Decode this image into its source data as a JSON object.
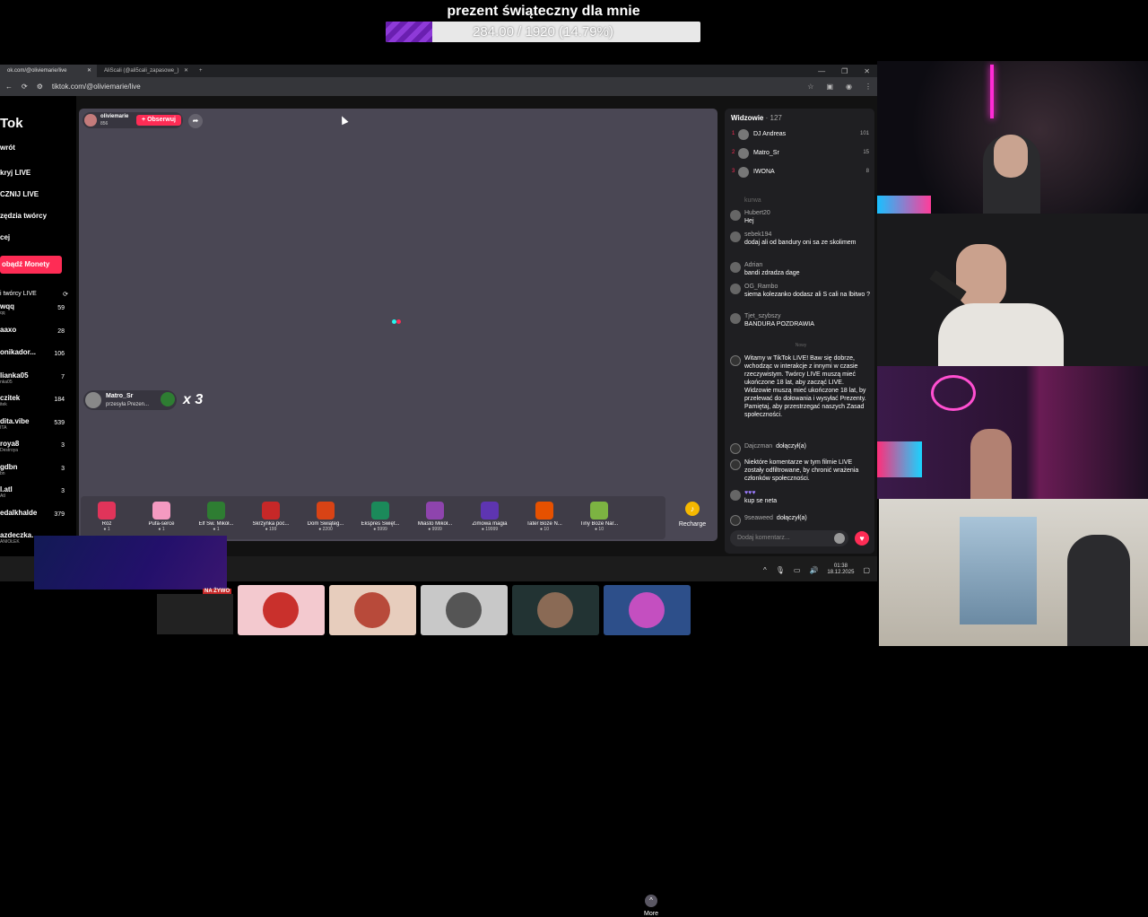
{
  "goal": {
    "title": "prezent świąteczny dla mnie",
    "progress_text": "284.00 / 1920 (14.79%)",
    "fraction": 0.1479
  },
  "browser": {
    "tabs": [
      {
        "label": "ok.com/@oliviemarie/live",
        "active": true
      },
      {
        "label": "AliScali (@ali5cali_zapasowe_)",
        "active": false
      }
    ],
    "url": "tiktok.com/@oliviemarie/live"
  },
  "nav": {
    "brand": "Tok",
    "items": [
      "wrót",
      "kryj LIVE",
      "CZNIJ LIVE",
      "zędzia twórcy",
      "cej"
    ],
    "coins_button": "obądź Monety",
    "creators_header": "i twórcy LIVE",
    "creators": [
      {
        "name": "wqq",
        "sub": "qq",
        "count": "59"
      },
      {
        "name": "aaxo",
        "sub": "",
        "count": "28"
      },
      {
        "name": "onikador...",
        "sub": "",
        "count": "106"
      },
      {
        "name": "lianka05",
        "sub": "nka05",
        "count": "7"
      },
      {
        "name": "czitek",
        "sub": "itek",
        "count": "184"
      },
      {
        "name": "dita.vibe",
        "sub": "ITA",
        "count": "539"
      },
      {
        "name": "roya8",
        "sub": "Destroya",
        "count": "3"
      },
      {
        "name": "gdbn",
        "sub": "bn",
        "count": "3"
      },
      {
        "name": "l.atl",
        "sub": "Atl",
        "count": "3"
      },
      {
        "name": "edalkhalde",
        "sub": "",
        "count": "379"
      },
      {
        "name": "azdeczka.",
        "sub": "ANIOŁEK",
        "count": ""
      }
    ]
  },
  "stream": {
    "host_name": "oliviemarie",
    "host_likes": "856",
    "follow_label": "+ Obserwuj",
    "gift_popup": {
      "user": "Matro_Sr",
      "text": "przesyła Prezen...",
      "multiplier": "x 3"
    }
  },
  "gifts": [
    {
      "name": "Róż",
      "price": "1",
      "color": "#e0345a"
    },
    {
      "name": "Pufa-serce",
      "price": "1",
      "color": "#f49ac1"
    },
    {
      "name": "Elf Św. Mikoł...",
      "price": "1",
      "color": "#2e7d32"
    },
    {
      "name": "Skrzynka poc...",
      "price": "199",
      "color": "#c62828"
    },
    {
      "name": "Dom Świąteg...",
      "price": "2200",
      "color": "#d84315"
    },
    {
      "name": "Ekspres Święt...",
      "price": "5999",
      "color": "#1b8a5a"
    },
    {
      "name": "Miasto Mikoł...",
      "price": "9999",
      "color": "#8e44ad"
    },
    {
      "name": "Zimowa magia",
      "price": "19999",
      "color": "#5e35b1"
    },
    {
      "name": "Tater Boże N...",
      "price": "10",
      "color": "#e65100"
    },
    {
      "name": "Tiny Boże Nar...",
      "price": "10",
      "color": "#7cb342"
    }
  ],
  "gift_controls": {
    "more": "More",
    "recharge": "Recharge"
  },
  "chat": {
    "viewers_title": "Widzowie",
    "viewers_count": "· 127",
    "top_viewers": [
      {
        "rank": "1",
        "name": "DJ Andreas",
        "score": "101"
      },
      {
        "rank": "2",
        "name": "Matro_Sr",
        "score": "15"
      },
      {
        "rank": "3",
        "name": "IWONA",
        "score": "8"
      }
    ],
    "messages": [
      {
        "author": "kurwa",
        "text": ""
      },
      {
        "author": "Hubert20",
        "text": "Hej"
      },
      {
        "author": "sebek194",
        "text": "dodaj ali od bandury oni sa ze skolimem"
      },
      {
        "author": "Adrian",
        "text": "bandi zdradza dage"
      },
      {
        "author": "OG_Rambo",
        "text": "siema kolezanko dodasz ali S cali na lbitwo ?"
      },
      {
        "author": "Tjet_szybszy",
        "text": "BANDURA POZDRAWIA"
      }
    ],
    "new_label": "Nowy",
    "system_notice": "Witamy w TikTok LIVE! Baw się dobrze, wchodząc w interakcje z innymi w czasie rzeczywistym. Twórcy LIVE muszą mieć ukończone 18 lat, aby zacząć LIVE. Widzowie muszą mieć ukończone 18 lat, by przelewać do dołowania i wysyłać Prezenty. Pamiętaj, aby przestrzegać naszych Zasad społeczności.",
    "join1": {
      "user": "Dajczman",
      "action": "dołączył(a)"
    },
    "filter_notice": "Niektóre komentarze w tym filmie LIVE zostały odfiltrowane, by chronić wrażenia członków społeczności.",
    "last_msg": {
      "author": "",
      "text": "kup se neta"
    },
    "join2": {
      "user": "9seaweed",
      "action": "dołączył(a)"
    },
    "input_placeholder": "Dodaj komentarz..."
  },
  "taskbar": {
    "time": "01:38",
    "date": "18.12.2025"
  },
  "live_badge": "NA ŻYWO"
}
